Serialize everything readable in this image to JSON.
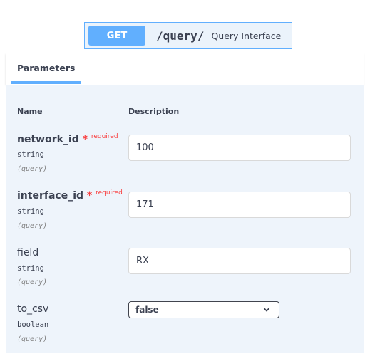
{
  "operation": {
    "method": "GET",
    "path": "/query/",
    "summary": "Query Interface",
    "accent": "#61affe"
  },
  "parameters": {
    "tab_label": "Parameters",
    "col_name": "Name",
    "col_description": "Description",
    "required_label": "required",
    "required_star": "*",
    "items": [
      {
        "name": "network_id",
        "type": "string",
        "in": "(query)",
        "value": "100"
      },
      {
        "name": "interface_id",
        "type": "string",
        "in": "(query)",
        "value": "171"
      },
      {
        "name": "field",
        "type": "string",
        "in": "(query)",
        "value": "RX"
      },
      {
        "name": "to_csv",
        "type": "boolean",
        "in": "(query)",
        "value": "false"
      }
    ]
  }
}
